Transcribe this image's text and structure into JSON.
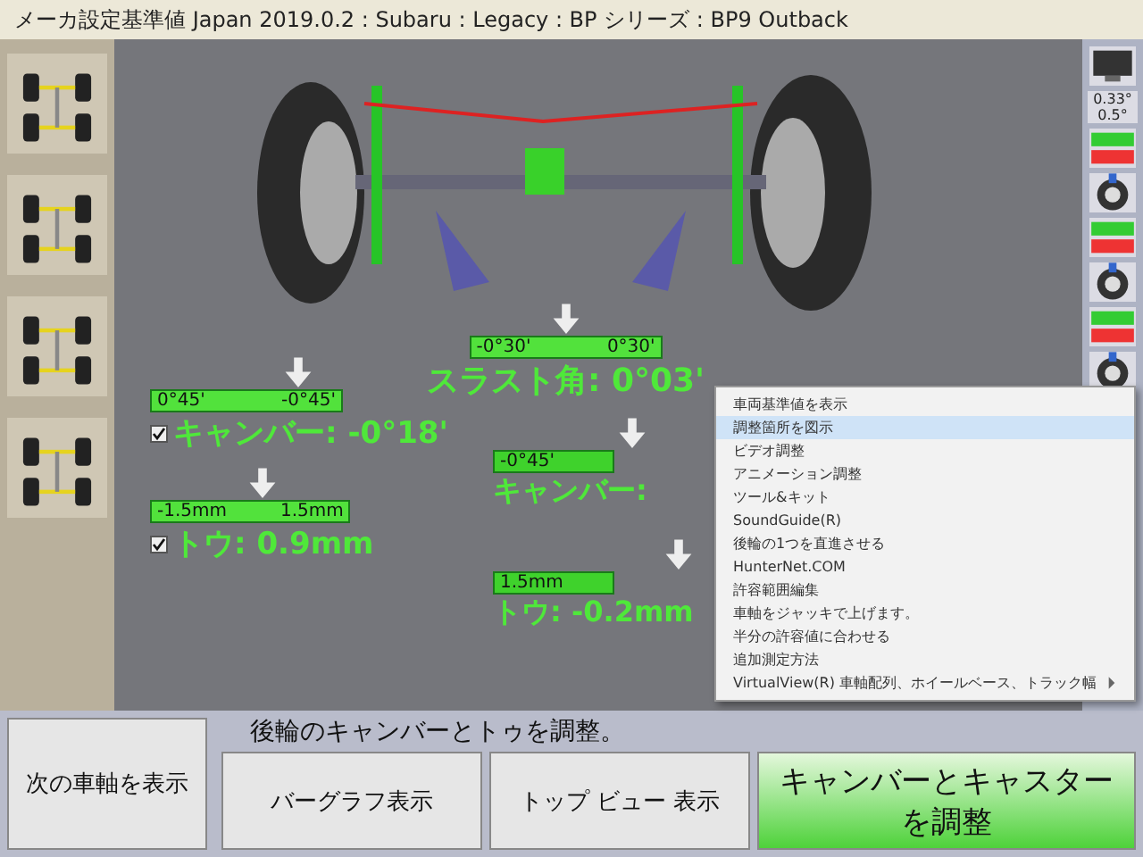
{
  "title_bar": {
    "title": "メーカ設定基準値 Japan 2019.0.2 : Subaru : Legacy : BP シリーズ : BP9  Outback"
  },
  "gauges": [
    {
      "kind": "small",
      "min": "-0°30'",
      "max": "0°30'",
      "label": "スラスト角: 0°03'"
    },
    {
      "kind": "small",
      "min": "0°45'",
      "max": "-0°45'",
      "label": "キャンバー: -0°18'",
      "checked": true
    },
    {
      "kind": "small",
      "min": "-1.5mm",
      "max": "1.5mm",
      "label": "トウ: 0.9mm",
      "checked": true
    },
    {
      "kind": "partial",
      "min": "-0°45'",
      "label": "キャンバー:"
    },
    {
      "kind": "partial",
      "min": "1.5mm",
      "label": "トウ: -0.2mm"
    }
  ],
  "toolbar": {
    "readings": [
      "0.33°",
      "0.5°"
    ]
  },
  "context_menu": {
    "items": [
      {
        "label": "車両基準値を表示",
        "selected": false,
        "submenu": false
      },
      {
        "label": "調整箇所を図示",
        "selected": true,
        "submenu": false
      },
      {
        "label": "ビデオ調整",
        "selected": false,
        "submenu": false
      },
      {
        "label": "アニメーション調整",
        "selected": false,
        "submenu": false
      },
      {
        "label": "ツール&キット",
        "selected": false,
        "submenu": false
      },
      {
        "label": "SoundGuide(R)",
        "selected": false,
        "submenu": false
      },
      {
        "label": "後輪の1つを直進させる",
        "selected": false,
        "submenu": false
      },
      {
        "label": "HunterNet.COM",
        "selected": false,
        "submenu": false
      },
      {
        "label": "許容範囲編集",
        "selected": false,
        "submenu": false
      },
      {
        "label": "車軸をジャッキで上げます。",
        "selected": false,
        "submenu": false
      },
      {
        "label": "半分の許容値に合わせる",
        "selected": false,
        "submenu": false
      },
      {
        "label": "追加測定方法",
        "selected": false,
        "submenu": false
      },
      {
        "label": "VirtualView(R) 車軸配列、ホイールベース、トラック幅",
        "selected": false,
        "submenu": true
      }
    ]
  },
  "instruction": "後輪のキャンバーとトゥを調整。",
  "buttons": [
    {
      "label": "次の車軸を表示",
      "kind": "plain"
    },
    {
      "label": "バーグラフ表示",
      "kind": "plain"
    },
    {
      "label": "トップ ビュー 表示",
      "kind": "plain"
    },
    {
      "label": "キャンバーとキャスターを調整",
      "kind": "primary"
    }
  ]
}
